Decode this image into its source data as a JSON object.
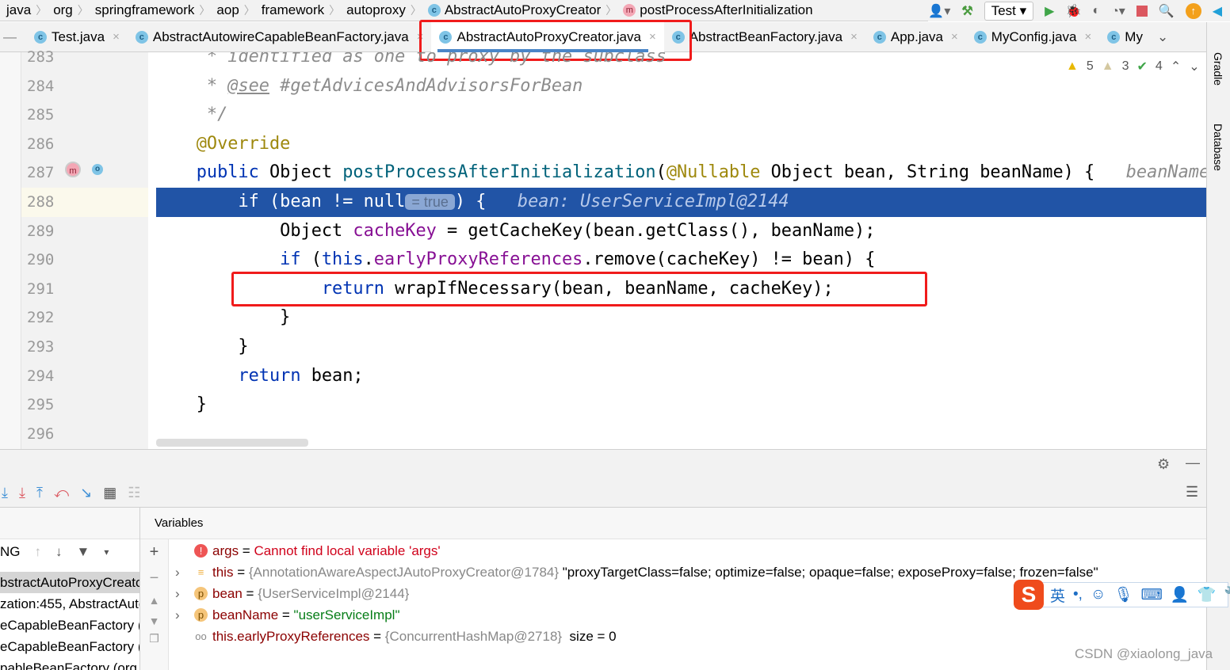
{
  "breadcrumb": [
    "java",
    "org",
    "springframework",
    "aop",
    "framework",
    "autoproxy",
    "AbstractAutoProxyCreator",
    "postProcessAfterInitialization"
  ],
  "toolbar": {
    "run_config": "Test"
  },
  "tabs": [
    {
      "label": "Test.java",
      "active": false
    },
    {
      "label": "AbstractAutowireCapableBeanFactory.java",
      "active": false
    },
    {
      "label": "AbstractAutoProxyCreator.java",
      "active": true
    },
    {
      "label": "AbstractBeanFactory.java",
      "active": false
    },
    {
      "label": "App.java",
      "active": false
    },
    {
      "label": "MyConfig.java",
      "active": false
    },
    {
      "label": "My",
      "active": false
    }
  ],
  "inspections": {
    "warnings": "5",
    "weak_warnings": "3",
    "ok": "4"
  },
  "side_tools": [
    "Gradle",
    "Database"
  ],
  "code": {
    "lines": [
      {
        "n": "283",
        "t": [
          [
            "    ",
            ""
          ],
          [
            " * identified as one to proxy by the subclass",
            "cm"
          ]
        ]
      },
      {
        "n": "284",
        "t": [
          [
            "     * ",
            "cm"
          ],
          [
            "@see",
            "tag"
          ],
          [
            " #getAdvicesAndAdvisorsForBean",
            "cm"
          ]
        ]
      },
      {
        "n": "285",
        "t": [
          [
            "     */",
            "cm"
          ]
        ]
      },
      {
        "n": "286",
        "t": [
          [
            "    ",
            ""
          ],
          [
            "@Override",
            "ann"
          ]
        ]
      },
      {
        "n": "287",
        "t": [
          [
            "    ",
            ""
          ],
          [
            "public",
            "kw"
          ],
          [
            " Object ",
            ""
          ],
          [
            "postProcessAfterInitialization",
            "fn"
          ],
          [
            "(",
            ""
          ],
          [
            "@Nullable",
            "ann"
          ],
          [
            " Object bean, String beanName) {   ",
            ""
          ],
          [
            "beanName: ",
            "hint"
          ]
        ]
      },
      {
        "n": "288",
        "exec": true,
        "t": [
          [
            "        ",
            ""
          ],
          [
            "if",
            "kw"
          ],
          [
            " (bean != null",
            ""
          ],
          [
            "= true",
            "inl"
          ],
          [
            ") {   ",
            ""
          ],
          [
            "bean: UserServiceImpl@2144",
            "hint"
          ]
        ]
      },
      {
        "n": "289",
        "t": [
          [
            "            Object ",
            ""
          ],
          [
            "cacheKey",
            "fld"
          ],
          [
            " = getCacheKey(bean.getClass(), beanName);",
            ""
          ]
        ]
      },
      {
        "n": "290",
        "t": [
          [
            "            ",
            ""
          ],
          [
            "if",
            "kw"
          ],
          [
            " (",
            ""
          ],
          [
            "this",
            "kw"
          ],
          [
            ".",
            ""
          ],
          [
            "earlyProxyReferences",
            "fld"
          ],
          [
            ".remove(cacheKey) != bean) {",
            ""
          ]
        ]
      },
      {
        "n": "291",
        "t": [
          [
            "                ",
            ""
          ],
          [
            "return",
            "kw"
          ],
          [
            " wrapIfNecessary(bean, beanName, cacheKey);",
            ""
          ]
        ]
      },
      {
        "n": "292",
        "t": [
          [
            "            }",
            ""
          ]
        ]
      },
      {
        "n": "293",
        "t": [
          [
            "        }",
            ""
          ]
        ]
      },
      {
        "n": "294",
        "t": [
          [
            "        ",
            ""
          ],
          [
            "return",
            "kw"
          ],
          [
            " bean;",
            ""
          ]
        ]
      },
      {
        "n": "295",
        "t": [
          [
            "    }",
            ""
          ]
        ]
      },
      {
        "n": "296",
        "t": [
          [
            "",
            ""
          ]
        ]
      }
    ]
  },
  "debugger": {
    "frames_filter": "NG",
    "frames": [
      "bstractAutoProxyCreato",
      "zation:455, AbstractAuto",
      "eCapableBeanFactory (o",
      "eCapableBeanFactory (o",
      "pableBeanFactory (org"
    ],
    "variables_title": "Variables",
    "variables": [
      {
        "icon": "error",
        "name": "args",
        "eq": " = ",
        "value": "Cannot find local variable 'args'",
        "kind": "error",
        "extra": ""
      },
      {
        "icon": "field",
        "name": "this",
        "eq": " = ",
        "value": "{AnnotationAwareAspectJAutoProxyCreator@1784}",
        "kind": "type",
        "extra": " \"proxyTargetClass=false; optimize=false; opaque=false; exposeProxy=false; frozen=false\""
      },
      {
        "icon": "param",
        "name": "bean",
        "eq": " = ",
        "value": "{UserServiceImpl@2144}",
        "kind": "type",
        "extra": ""
      },
      {
        "icon": "param",
        "name": "beanName",
        "eq": " = ",
        "value": "\"userServiceImpl\"",
        "kind": "string",
        "extra": ""
      },
      {
        "icon": "watch",
        "name": "this.earlyProxyReferences",
        "eq": " = ",
        "value": "{ConcurrentHashMap@2718}",
        "kind": "type",
        "extra": "  size = 0"
      }
    ]
  },
  "ime": {
    "lang": "英",
    "punct": "•,"
  },
  "watermark": "CSDN @xiaolong_java",
  "colors": {
    "highlight_box": "#f01b1b",
    "exec_line": "#2154a6",
    "active_tab_underline": "#4a86c8"
  }
}
